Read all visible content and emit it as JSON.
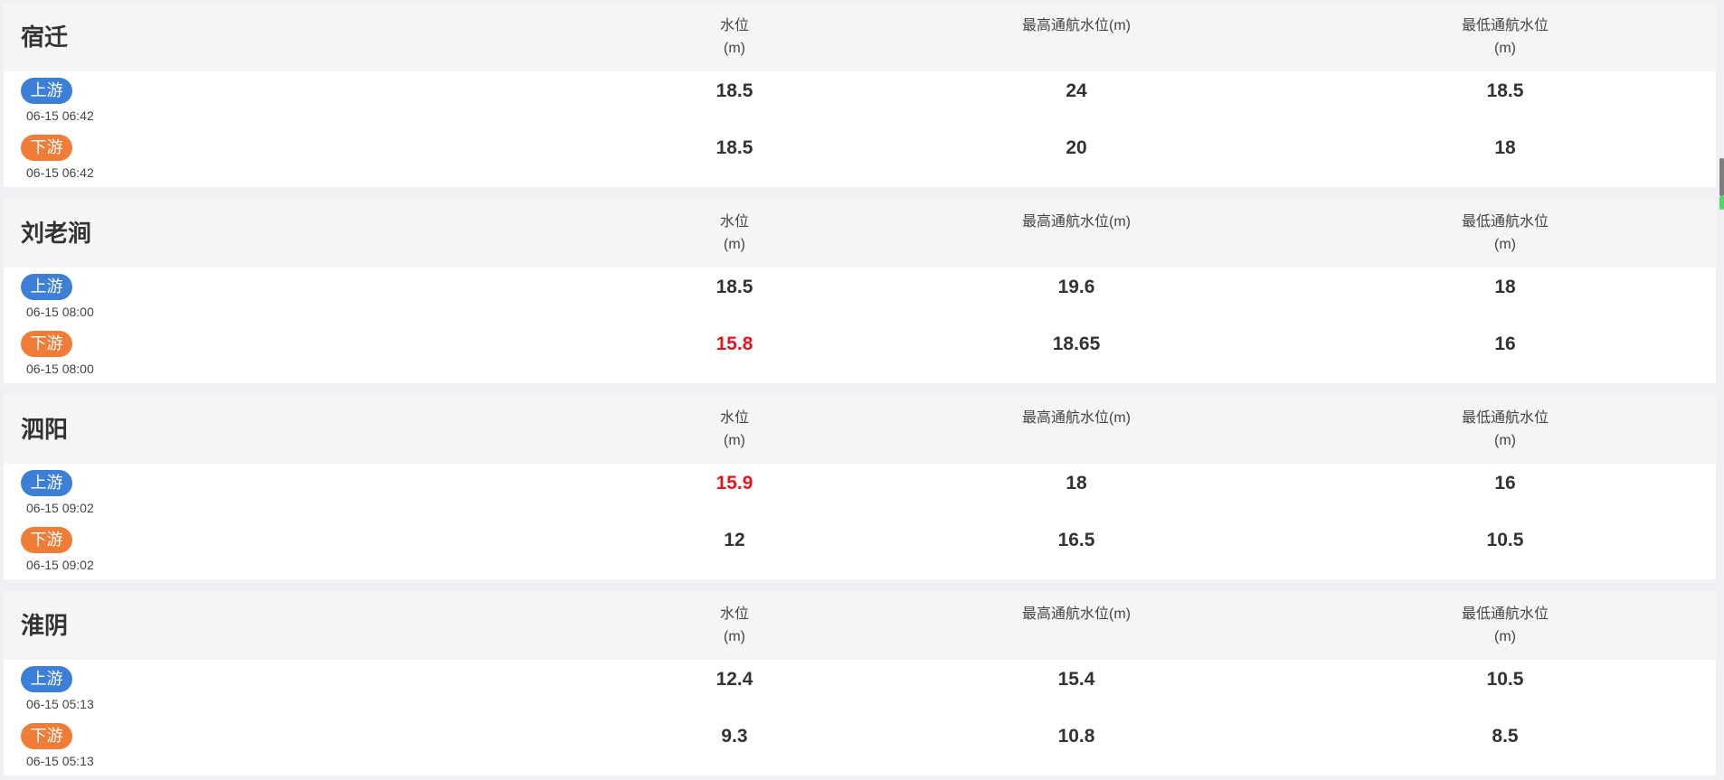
{
  "columns": {
    "water_level": [
      "水位",
      "(m)"
    ],
    "max_nav": [
      "最高通航水位(m)"
    ],
    "min_nav": [
      "最低通航水位",
      "(m)"
    ]
  },
  "labels": {
    "upstream": "上游",
    "downstream": "下游"
  },
  "colors": {
    "upstream_badge": "#3c7fd6",
    "downstream_badge": "#ef7d37",
    "alert_value": "#e8141c",
    "scroll_indicator": "#4cd964"
  },
  "stations": [
    {
      "name": "宿迁",
      "up": {
        "time": "06-15 06:42",
        "level": "18.5",
        "max": "24",
        "min": "18.5",
        "level_alert": false
      },
      "down": {
        "time": "06-15 06:42",
        "level": "18.5",
        "max": "20",
        "min": "18",
        "level_alert": false
      }
    },
    {
      "name": "刘老涧",
      "up": {
        "time": "06-15 08:00",
        "level": "18.5",
        "max": "19.6",
        "min": "18",
        "level_alert": false
      },
      "down": {
        "time": "06-15 08:00",
        "level": "15.8",
        "max": "18.65",
        "min": "16",
        "level_alert": true
      }
    },
    {
      "name": "泗阳",
      "up": {
        "time": "06-15 09:02",
        "level": "15.9",
        "max": "18",
        "min": "16",
        "level_alert": true
      },
      "down": {
        "time": "06-15 09:02",
        "level": "12",
        "max": "16.5",
        "min": "10.5",
        "level_alert": false
      }
    },
    {
      "name": "淮阴",
      "up": {
        "time": "06-15 05:13",
        "level": "12.4",
        "max": "15.4",
        "min": "10.5",
        "level_alert": false
      },
      "down": {
        "time": "06-15 05:13",
        "level": "9.3",
        "max": "10.8",
        "min": "8.5",
        "level_alert": false
      }
    }
  ]
}
